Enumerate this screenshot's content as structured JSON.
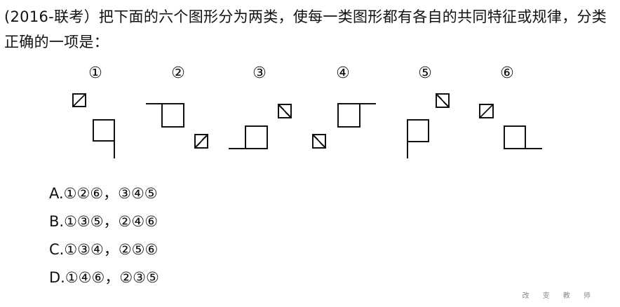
{
  "question": {
    "text": "(2016-联考）把下面的六个图形分为两类，使每一类图形都有各自的共同特征或规律，分类正确的一项是："
  },
  "figures": [
    {
      "label": "①"
    },
    {
      "label": "②"
    },
    {
      "label": "③"
    },
    {
      "label": "④"
    },
    {
      "label": "⑤"
    },
    {
      "label": "⑥"
    }
  ],
  "options": [
    {
      "text": "A.①②⑥，③④⑤"
    },
    {
      "text": "B.①③⑤，②④⑥"
    },
    {
      "text": "C.①③④，②⑤⑥"
    },
    {
      "text": "D.①④⑥，②③⑤"
    }
  ],
  "watermark": "改 变 教 师"
}
